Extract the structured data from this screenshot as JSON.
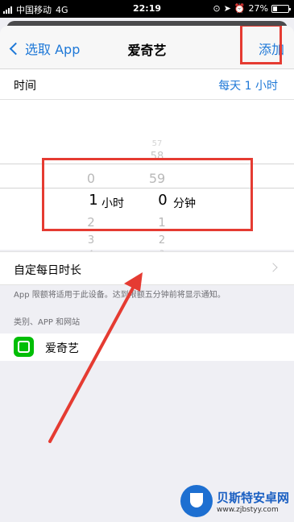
{
  "status_bar": {
    "carrier": "中国移动",
    "network": "4G",
    "time": "22:19",
    "battery": "27%",
    "battery_level": 0.27
  },
  "nav": {
    "back_label": "选取 App",
    "title": "爱奇艺",
    "add_label": "添加"
  },
  "time_setting": {
    "label": "时间",
    "value": "每天 1 小时"
  },
  "picker": {
    "hours": {
      "above": [
        "0"
      ],
      "selected": "1",
      "below": [
        "2",
        "3",
        "4"
      ],
      "unit": "小时"
    },
    "minutes": {
      "above": [
        "57",
        "58",
        "59"
      ],
      "selected": "0",
      "below": [
        "1",
        "2",
        "3"
      ],
      "unit": "分钟"
    }
  },
  "custom_daily": {
    "label": "自定每日时长"
  },
  "note": "App 限额将适用于此设备。达到限额五分钟前将显示通知。",
  "section": {
    "header": "类别、APP 和网站"
  },
  "apps": [
    {
      "name": "爱奇艺",
      "icon": "iqiyi-icon",
      "color": "#00be06"
    }
  ],
  "watermark": {
    "name": "贝斯特安卓网",
    "url": "www.zjbstyy.com"
  },
  "colors": {
    "accent": "#1e78d7",
    "highlight": "#e53b32"
  }
}
